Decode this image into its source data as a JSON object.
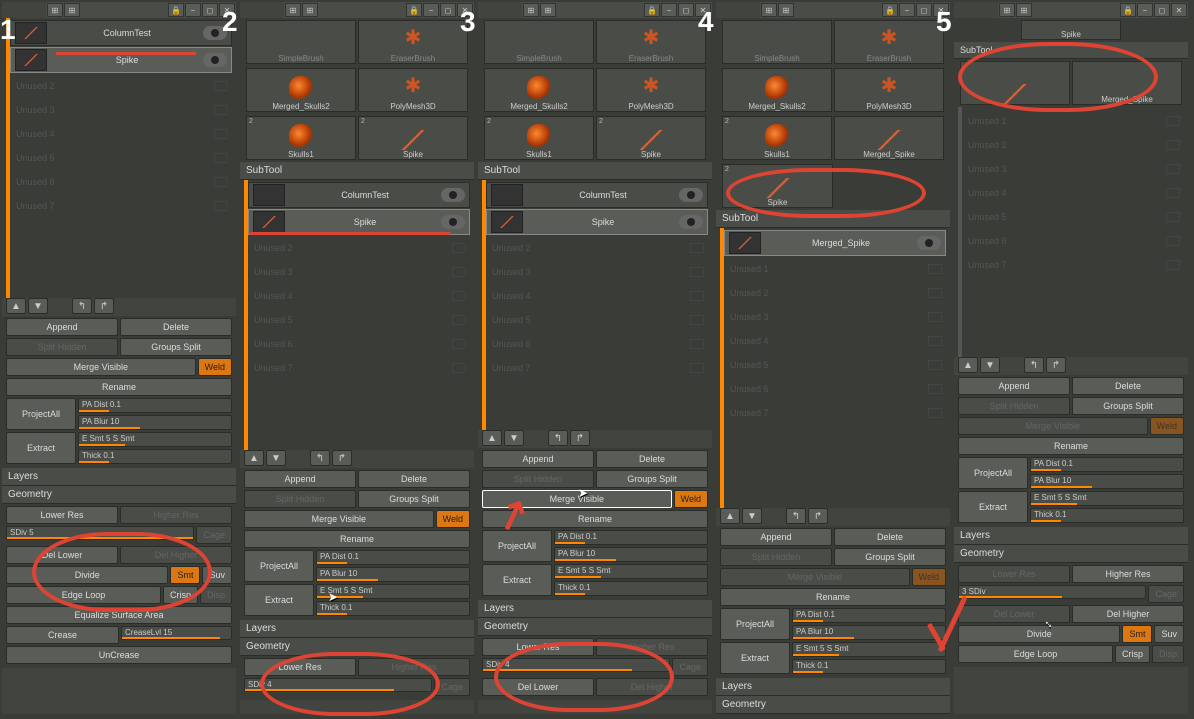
{
  "tool_names": {
    "column_test": "ColumnTest",
    "spike": "Spike",
    "simple_brush": "SimpleBrush",
    "eraser_brush": "EraserBrush",
    "merged_skulls2": "Merged_Skulls2",
    "polymesh3d": "PolyMesh3D",
    "skulls1": "Skulls1",
    "merged_spike": "Merged_Spike"
  },
  "sections": {
    "subtool": "SubTool",
    "layers": "Layers",
    "geometry": "Geometry"
  },
  "unused": {
    "u1": "Unused 1",
    "u2": "Unused 2",
    "u3": "Unused 3",
    "u4": "Unused 4",
    "u5": "Unused 5",
    "u6": "Unused 6",
    "u7": "Unused 7"
  },
  "btns": {
    "append": "Append",
    "delete": "Delete",
    "split_hidden": "Split Hidden",
    "groups_split": "Groups Split",
    "merge_visible": "Merge Visible",
    "weld": "Weld",
    "rename": "Rename",
    "project_all": "ProjectAll",
    "extract": "Extract",
    "lower_res": "Lower Res",
    "higher_res": "Higher Res",
    "del_lower": "Del Lower",
    "del_higher": "Del Higher",
    "cage": "Cage",
    "divide": "Divide",
    "smt": "Smt",
    "suv": "Suv",
    "edge_loop": "Edge Loop",
    "crisp": "Crisp",
    "disp": "Disp",
    "equalize": "Equalize Surface Area",
    "crease": "Crease",
    "uncrease": "UnCrease"
  },
  "sliders": {
    "pa_dist": "PA Dist 0.1",
    "pa_blur": "PA Blur 10",
    "e_smt": "E Smt 5",
    "s_smt": "S Smt",
    "thick": "Thick 0.1",
    "sdiv5": "SDiv 5",
    "sdiv4": "SDiv 4",
    "sdiv3": "3 SDiv",
    "creaselvl": "CreaseLvl 15"
  },
  "steps": {
    "s1": "1",
    "s2": "2",
    "s3": "3",
    "s4": "4",
    "s5": "5"
  },
  "count2": "2"
}
